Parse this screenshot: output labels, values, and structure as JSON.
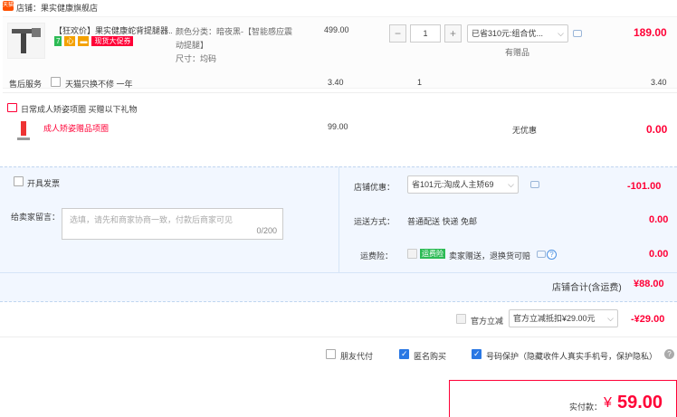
{
  "store": {
    "logo_text": "天猫",
    "label": "店铺：果实健康旗舰店"
  },
  "item": {
    "title": "【狂欢价】果实健康蛇背提腿器...",
    "tags": [
      "7",
      "心",
      "▬"
    ],
    "promo_tag": "现货大促券",
    "sku_color": "颜色分类：暗夜黑-【智能感应震",
    "sku_color2": "动提腿】",
    "sku_size": "尺寸：均码",
    "price": "499.00",
    "quantity": "1",
    "discount_select": "已省310元:组合优...",
    "has_gift": "有赠品",
    "subtotal": "189.00"
  },
  "service": {
    "label": "售后服务",
    "option": "天猫只换不修 一年",
    "price": "3.40",
    "qty": "1",
    "subtotal": "3.40"
  },
  "gift": {
    "header": "日常成人矫姿项圈  买赠以下礼物",
    "name": "成人矫姿赠品项圈",
    "price": "99.00",
    "discount": "无优惠",
    "subtotal": "0.00"
  },
  "invoice": {
    "label": "开具发票"
  },
  "message": {
    "label": "给卖家留言：",
    "placeholder": "选填，请先和商家协商一致，付款后商家可见",
    "count": "0/200"
  },
  "store_coupon": {
    "label": "店铺优惠：",
    "value": "省101元:淘成人主矫69",
    "amount": "-101.00"
  },
  "shipping": {
    "label": "运送方式：",
    "value": "普通配送 快递 免邮",
    "amount": "0.00"
  },
  "insurance": {
    "label": "运费险：",
    "tag": "运费险",
    "text": "卖家赠送，退换货可赔",
    "amount": "0.00"
  },
  "store_total": {
    "label": "店铺合计(含运费)",
    "amount": "¥88.00"
  },
  "tmall_coupon": {
    "label": "官方立减",
    "value": "官方立减抵扣¥29.00元",
    "amount": "-¥29.00"
  },
  "options": {
    "friend_pay": "朋友代付",
    "anonymous": "匿名购买",
    "privacy": "号码保护（隐藏收件人真实手机号，保护隐私）"
  },
  "final": {
    "label": "实付款：",
    "currency": "¥",
    "amount": "59.00"
  },
  "colors": {
    "accent": "#ff0036",
    "link_blue": "#2a78e4",
    "panel_bg": "#f2f7ff"
  }
}
